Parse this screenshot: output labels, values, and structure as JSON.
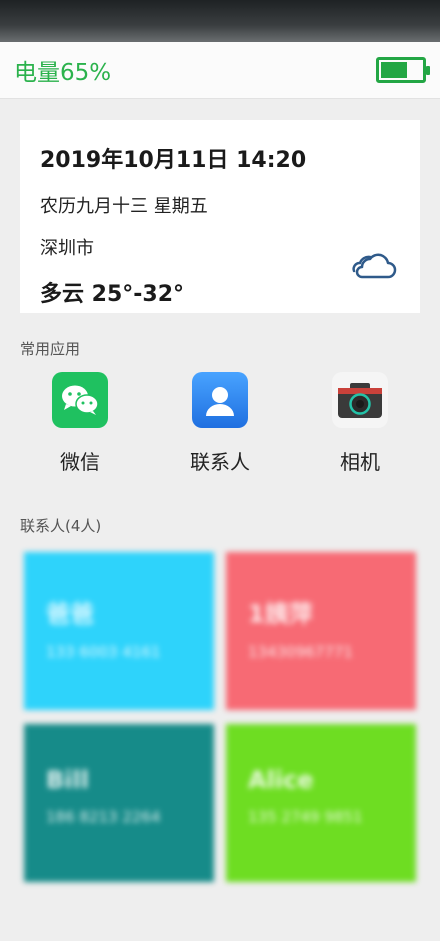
{
  "status": {
    "battery_text": "电量65%",
    "battery_level": 0.65,
    "accent_color": "#2bb24c"
  },
  "info_card": {
    "datetime": "2019年10月11日 14:20",
    "lunar": "农历九月十三 星期五",
    "city": "深圳市",
    "weather": "多云 25°-32°",
    "weather_icon": "cloud-icon"
  },
  "apps_section": {
    "title": "常用应用",
    "items": [
      {
        "label": "微信",
        "icon": "wechat-icon",
        "color": "#1fc160"
      },
      {
        "label": "联系人",
        "icon": "contacts-icon",
        "color": "#2f86f5"
      },
      {
        "label": "相机",
        "icon": "camera-icon",
        "color": "#3a3a3a"
      }
    ]
  },
  "contacts_section": {
    "title": "联系人(4人)",
    "items": [
      {
        "name": "爸爸",
        "phone": "133 6003 4161",
        "color": "#2ed3fb"
      },
      {
        "name": "1姨萍",
        "phone": "13430967771",
        "color": "#f76a74"
      },
      {
        "name": "Bill",
        "phone": "186 8213 2264",
        "color": "#168b89"
      },
      {
        "name": "Alice",
        "phone": "135 2749 9851",
        "color": "#6edd22"
      }
    ]
  }
}
